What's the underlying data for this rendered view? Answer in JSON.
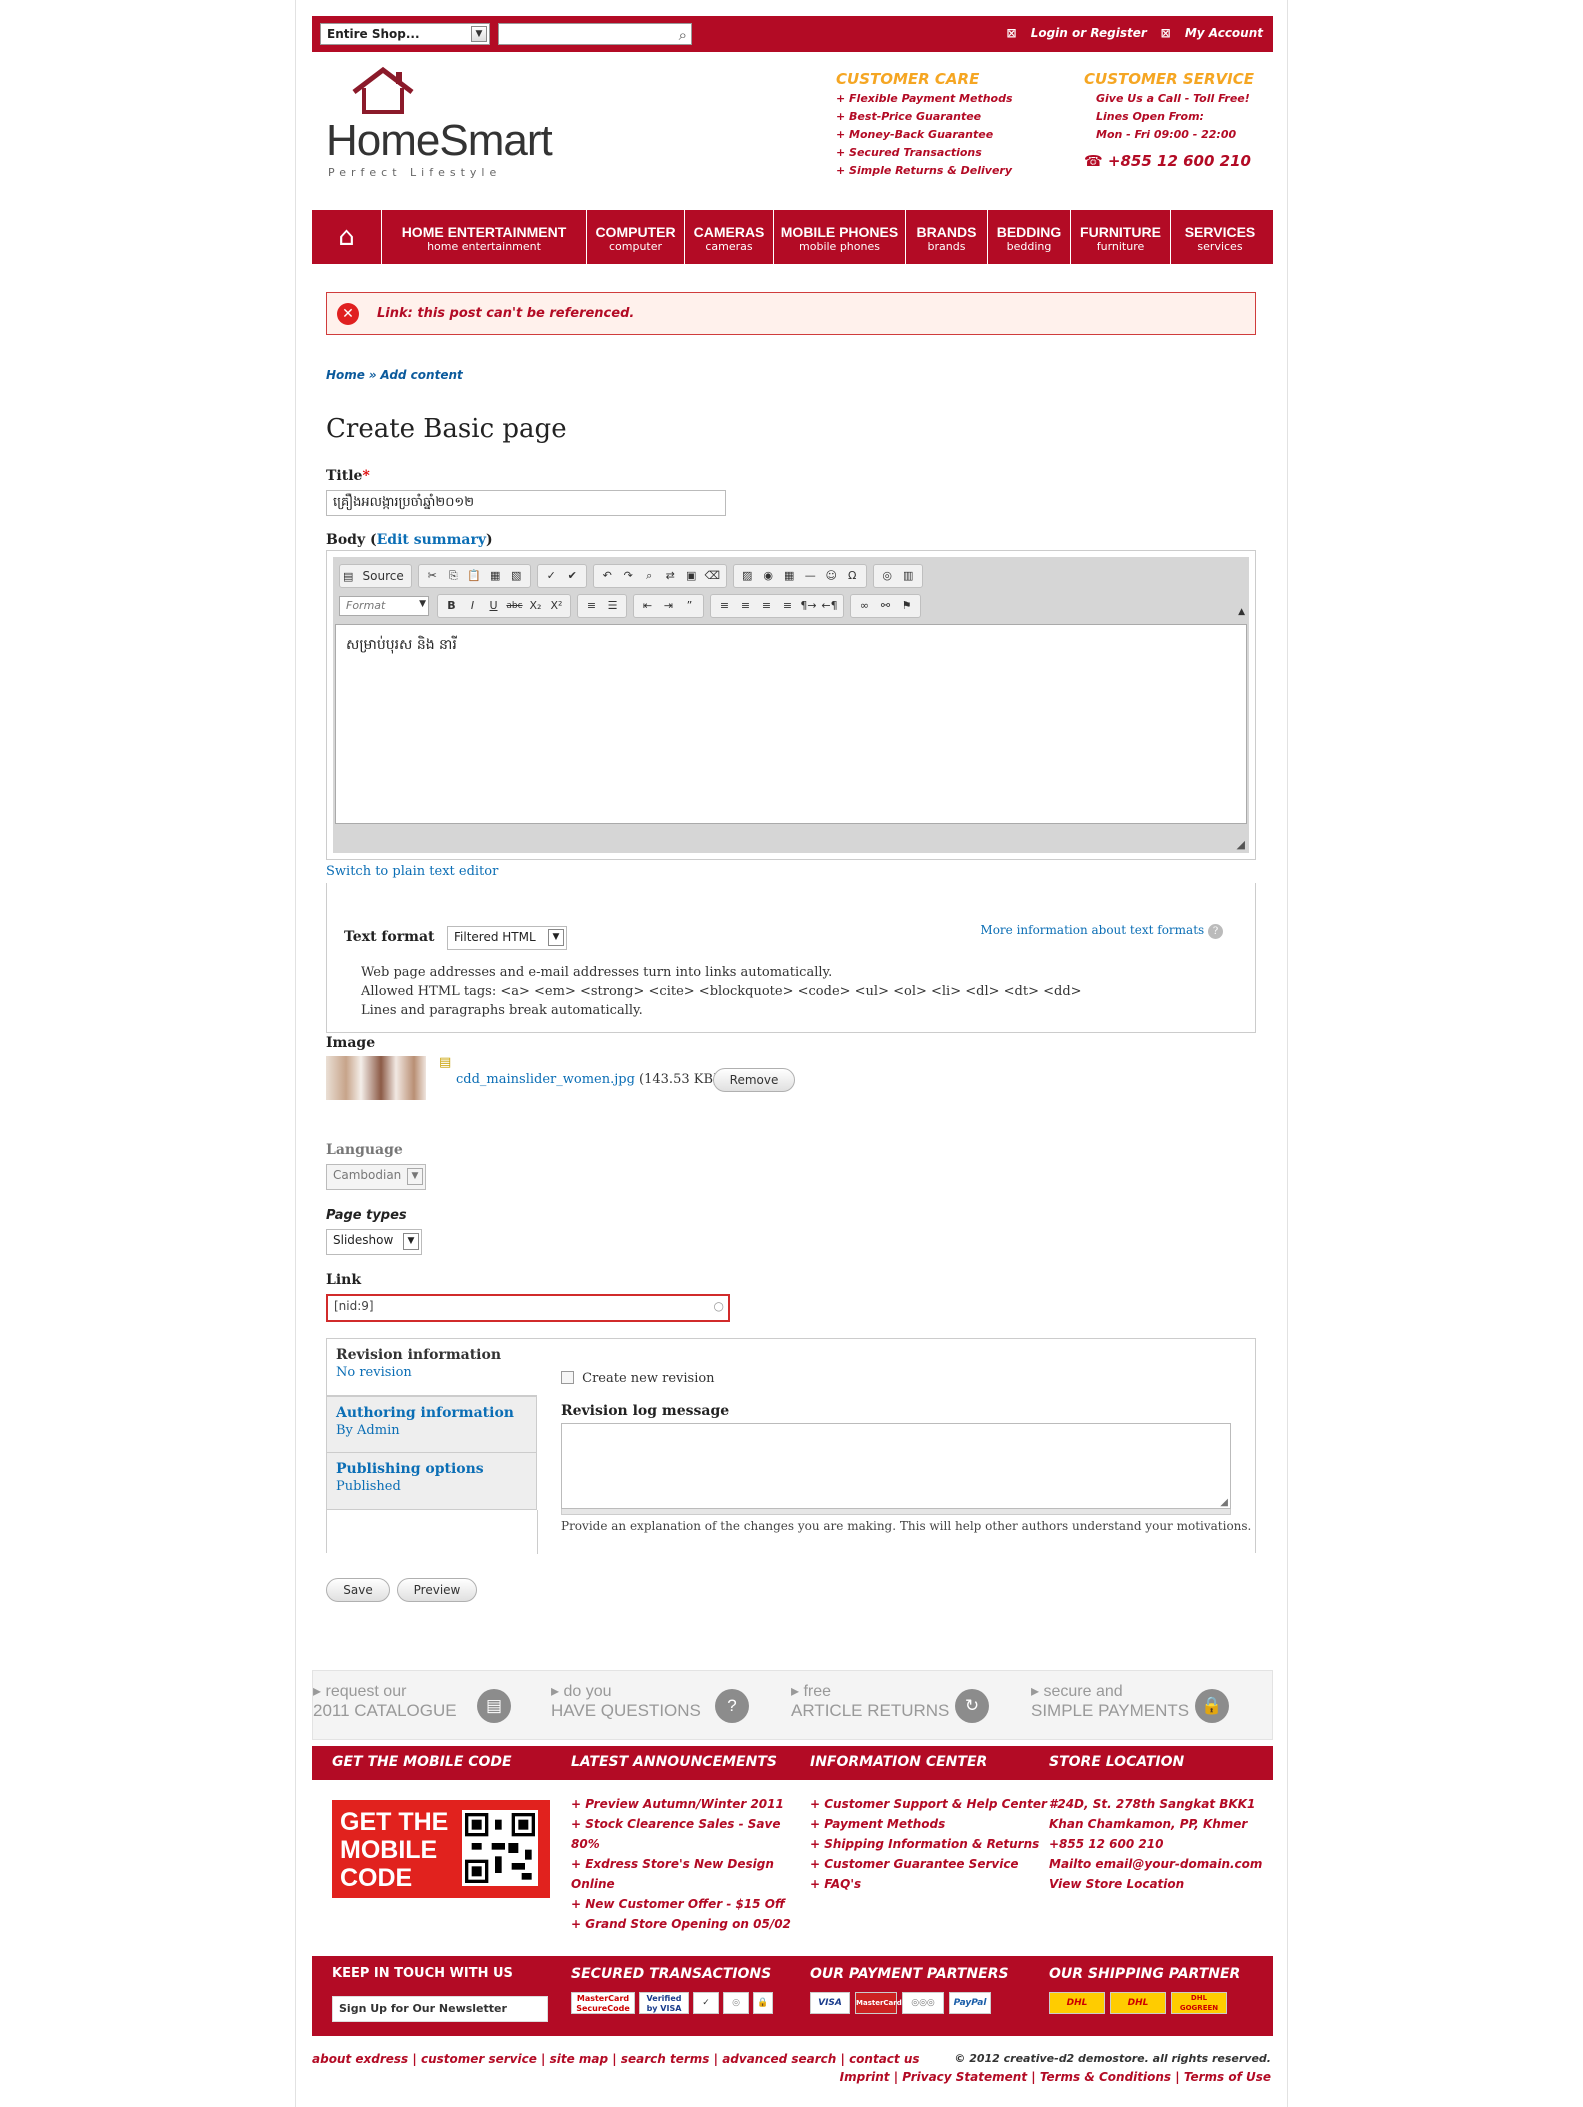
{
  "topbar": {
    "shop_select": "Entire Shop...",
    "search_placeholder": "",
    "login": "Login or Register",
    "account": "My Account"
  },
  "logo": {
    "name": "HomeSmart",
    "tagline": "Perfect Lifestyle"
  },
  "care": {
    "title": "CUSTOMER CARE",
    "items": [
      "+ Flexible Payment Methods",
      "+ Best-Price Guarantee",
      "+ Money-Back Guarantee",
      "+ Secured Transactions",
      "+ Simple Returns & Delivery"
    ]
  },
  "service": {
    "title": "CUSTOMER SERVICE",
    "lines": [
      "Give Us a Call - Toll Free!",
      "Lines Open From:",
      "Mon - Fri 09:00 - 22:00"
    ],
    "phone": "+855 12 600 210"
  },
  "nav": [
    {
      "title": "HOME ENTERTAINMENT",
      "sub": "home entertainment"
    },
    {
      "title": "COMPUTER",
      "sub": "computer"
    },
    {
      "title": "CAMERAS",
      "sub": "cameras"
    },
    {
      "title": "MOBILE PHONES",
      "sub": "mobile phones"
    },
    {
      "title": "BRANDS",
      "sub": "brands"
    },
    {
      "title": "BEDDING",
      "sub": "bedding"
    },
    {
      "title": "FURNITURE",
      "sub": "furniture"
    },
    {
      "title": "SERVICES",
      "sub": "services"
    }
  ],
  "error": "Link: this post can't be referenced.",
  "breadcrumb": {
    "home": "Home",
    "sep": "»",
    "current": "Add content"
  },
  "page_title": "Create Basic page",
  "form": {
    "title_label": "Title",
    "title_value": "គ្រឿងអលង្ការប្រចាំឆ្នាំ២០១២",
    "body_label": "Body",
    "edit_summary": "Edit summary",
    "source": "Source",
    "format_placeholder": "Format",
    "body_text": "សម្រាប់បុរស និង នារី",
    "switch_editor": "Switch to plain text editor",
    "text_format_label": "Text format",
    "text_format_value": "Filtered HTML",
    "more_info": "More information about text formats",
    "help": [
      "Web page addresses and e-mail addresses turn into links automatically.",
      "Allowed HTML tags: <a> <em> <strong> <cite> <blockquote> <code> <ul> <ol> <li> <dl> <dt> <dd>",
      "Lines and paragraphs break automatically."
    ],
    "image_label": "Image",
    "image_file": "cdd_mainslider_women.jpg",
    "image_size": "(143.53 KB)",
    "remove": "Remove",
    "language_label": "Language",
    "language_value": "Cambodian",
    "page_types_label": "Page types",
    "page_types_value": "Slideshow",
    "link_label": "Link",
    "link_value": "[nid:9]"
  },
  "revision": {
    "tabs": [
      {
        "title": "Revision information",
        "sub": "No revision"
      },
      {
        "title": "Authoring information",
        "sub": "By Admin"
      },
      {
        "title": "Publishing options",
        "sub": "Published"
      }
    ],
    "checkbox": "Create new revision",
    "log_label": "Revision log message",
    "log_help": "Provide an explanation of the changes you are making. This will help other authors understand your motivations."
  },
  "actions": {
    "save": "Save",
    "preview": "Preview"
  },
  "features": [
    {
      "a": "request our",
      "b": "2011 CATALOGUE"
    },
    {
      "a": "do you",
      "b": "HAVE QUESTIONS"
    },
    {
      "a": "free",
      "b": "ARTICLE RETURNS"
    },
    {
      "a": "secure and",
      "b": "SIMPLE PAYMENTS"
    }
  ],
  "footer": {
    "headings": [
      "GET THE MOBILE CODE",
      "LATEST ANNOUNCEMENTS",
      "INFORMATION CENTER",
      "STORE LOCATION"
    ],
    "mobile_code": [
      "GET THE",
      "MOBILE",
      "CODE"
    ],
    "announcements": [
      "+ Preview Autumn/Winter 2011",
      "+ Stock Clearence Sales - Save",
      "80%",
      "+ Exdress Store's New Design",
      "Online",
      "+ New Customer Offer - $15 Off",
      "+ Grand Store Opening on 05/02"
    ],
    "info": [
      "+ Customer Support & Help Center",
      "+ Payment Methods",
      "+ Shipping Information & Returns",
      "+ Customer Guarantee Service",
      "+ FAQ's"
    ],
    "store": [
      "#24D, St. 278th Sangkat BKK1",
      "Khan Chamkamon, PP, Khmer",
      "+855 12 600 210",
      "Mailto email@your-domain.com",
      "View Store Location"
    ],
    "bottom_headings": [
      "KEEP IN TOUCH WITH US",
      "SECURED TRANSACTIONS",
      "OUR PAYMENT PARTNERS",
      "OUR SHIPPING PARTNER"
    ],
    "newsletter": "Sign Up for Our Newsletter",
    "secured_badges": [
      "MasterCard SecureCode",
      "Verified by VISA"
    ],
    "payment_badges": [
      "VISA",
      "MasterCard",
      "PayPal"
    ],
    "shipping_badges": [
      "DHL",
      "DHL",
      "DHL GOGREEN"
    ],
    "links": [
      "about exdress",
      "customer service",
      "site map",
      "search terms",
      "advanced search",
      "contact us"
    ],
    "copyright": "© 2012 creative-d2 demostore. all rights reserved.",
    "legal": [
      "Imprint",
      "Privacy Statement",
      "Terms & Conditions",
      "Terms of Use"
    ]
  },
  "colors": {
    "brand_red": "#b30b25",
    "accent_orange": "#f5a623"
  }
}
